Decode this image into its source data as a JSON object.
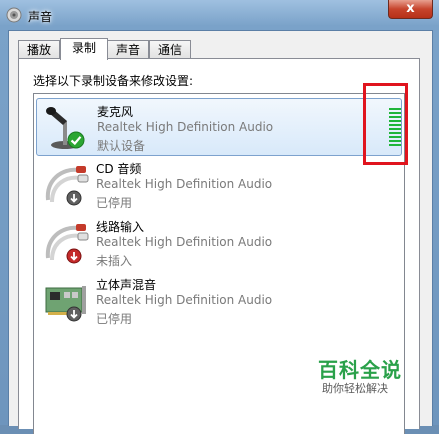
{
  "window": {
    "title": "声音",
    "close_label": "x"
  },
  "tabs": [
    {
      "label": "播放",
      "active": false
    },
    {
      "label": "录制",
      "active": true
    },
    {
      "label": "声音",
      "active": false
    },
    {
      "label": "通信",
      "active": false
    }
  ],
  "instruction": "选择以下录制设备来修改设置:",
  "devices": [
    {
      "name": "麦克风",
      "description": "Realtek High Definition Audio",
      "status": "默认设备",
      "icon": "microphone-icon",
      "badge": "default-check-icon",
      "selected": true
    },
    {
      "name": "CD 音频",
      "description": "Realtek High Definition Audio",
      "status": "已停用",
      "icon": "audio-cable-icon",
      "badge": "disabled-arrow-icon",
      "selected": false
    },
    {
      "name": "线路输入",
      "description": "Realtek High Definition Audio",
      "status": "未插入",
      "icon": "audio-cable-icon",
      "badge": "unplugged-arrow-icon",
      "selected": false
    },
    {
      "name": "立体声混音",
      "description": "Realtek High Definition Audio",
      "status": "已停用",
      "icon": "sound-card-icon",
      "badge": "disabled-arrow-icon",
      "selected": false
    }
  ],
  "level_meter": {
    "segments": 10,
    "color": "#1fb53a"
  },
  "watermark": {
    "main": "百科全说",
    "sub": "助你轻松解决"
  },
  "colors": {
    "highlight": "#e0141e",
    "accent": "#2aa14a"
  }
}
